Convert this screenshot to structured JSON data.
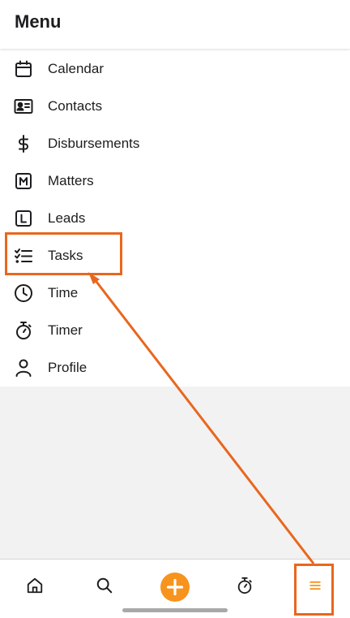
{
  "header": {
    "title": "Menu"
  },
  "menu": {
    "items": [
      {
        "label": "Calendar",
        "icon": "calendar-icon"
      },
      {
        "label": "Contacts",
        "icon": "contact-card-icon"
      },
      {
        "label": "Disbursements",
        "icon": "dollar-icon"
      },
      {
        "label": "Matters",
        "icon": "m-box-icon"
      },
      {
        "label": "Leads",
        "icon": "l-box-icon"
      },
      {
        "label": "Tasks",
        "icon": "checklist-icon"
      },
      {
        "label": "Time",
        "icon": "clock-icon"
      },
      {
        "label": "Timer",
        "icon": "stopwatch-icon"
      },
      {
        "label": "Profile",
        "icon": "person-icon"
      }
    ]
  },
  "bottom_nav": {
    "items": [
      {
        "icon": "home-icon"
      },
      {
        "icon": "search-icon"
      },
      {
        "icon": "plus-icon"
      },
      {
        "icon": "stopwatch-icon"
      },
      {
        "icon": "hamburger-menu-icon",
        "active": true
      }
    ]
  },
  "annotation": {
    "highlighted_items": [
      "Tasks",
      "hamburger-menu-button"
    ],
    "color": "#e8671e"
  },
  "colors": {
    "accent": "#f7941d",
    "annotation": "#e8671e",
    "text": "#1d1d1f",
    "background_gray": "#f2f2f2"
  }
}
